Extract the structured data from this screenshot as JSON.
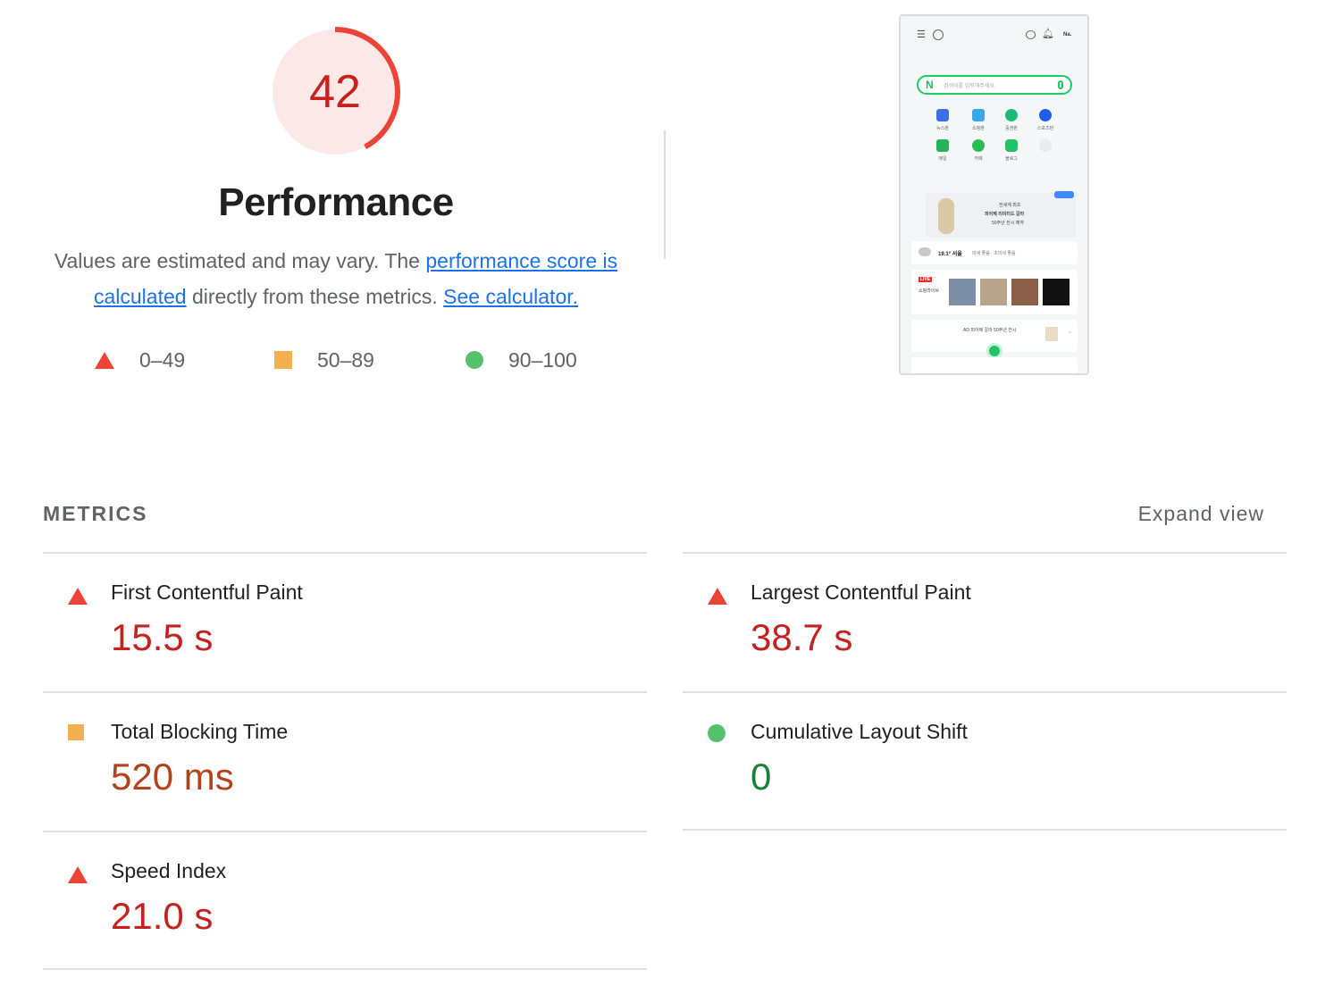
{
  "score": {
    "value": "42",
    "fraction": 0.42,
    "color": "#eb4335",
    "bg_color": "#fce8e6"
  },
  "category": {
    "title": "Performance"
  },
  "description": {
    "text1": "Values are estimated and may vary. The ",
    "link1": "performance score is calculated",
    "text2": " directly from these metrics. ",
    "link2": "See calculator."
  },
  "legend": {
    "fail": "0–49",
    "average": "50–89",
    "pass": "90–100"
  },
  "metrics_header": {
    "title": "METRICS",
    "expand": "Expand view"
  },
  "metrics": [
    {
      "name": "First Contentful Paint",
      "value": "15.5 s",
      "rating": "fail"
    },
    {
      "name": "Largest Contentful Paint",
      "value": "38.7 s",
      "rating": "fail"
    },
    {
      "name": "Total Blocking Time",
      "value": "520 ms",
      "rating": "average"
    },
    {
      "name": "Cumulative Layout Shift",
      "value": "0",
      "rating": "pass"
    },
    {
      "name": "Speed Index",
      "value": "21.0 s",
      "rating": "fail"
    }
  ],
  "colors": {
    "fail": "#eb4335",
    "average": "#f4b04f",
    "pass": "#55c26b",
    "link": "#1a73e8"
  },
  "screenshot": {
    "search_placeholder": "검색어를 입력해주세요.",
    "apps": [
      "뉴스판",
      "쇼핑판",
      "증권판",
      "스포츠판",
      "메일",
      "카페",
      "블로그"
    ],
    "banner_text": [
      "전세계 최초",
      "피아제 리미티드 갈라",
      "50주년 전시 예약"
    ],
    "weather": "19.1° 서울",
    "weather_detail": "미세 좋음 · 초미세 좋음",
    "live_label": "LIVE",
    "live_sub": "쇼핑라이브",
    "ad_text": "AD  피아제 갈라 50주년 전시",
    "user_short": "Na."
  }
}
